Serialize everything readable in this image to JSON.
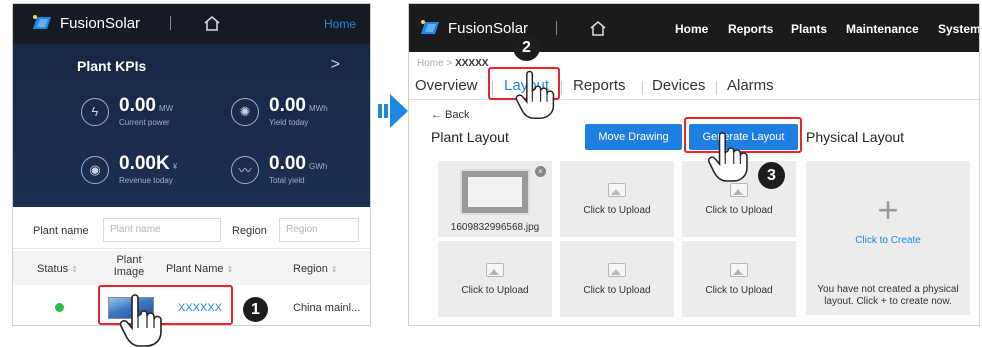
{
  "mobile": {
    "brand": "FusionSolar",
    "home_link": "Home",
    "kpi_title": "Plant KPIs",
    "kpi_arrow": ">",
    "kpis": [
      {
        "value": "0.00",
        "unit": "MW",
        "label": "Current power",
        "icon": "lightning-icon"
      },
      {
        "value": "0.00",
        "unit": "MWh",
        "label": "Yield today",
        "icon": "sun-icon"
      },
      {
        "value": "0.00K",
        "unit": "¥",
        "label": "Revenue today",
        "icon": "coins-icon"
      },
      {
        "value": "0.00",
        "unit": "GWh",
        "label": "Total yield",
        "icon": "chart-icon"
      }
    ],
    "filter": {
      "plant_name_label": "Plant name",
      "plant_name_placeholder": "Plant name",
      "region_label": "Region",
      "region_placeholder": "Region"
    },
    "table": {
      "headers": {
        "status": "Status",
        "image_line1": "Plant",
        "image_line2": "Image",
        "name": "Plant Name",
        "region": "Region"
      },
      "sort_glyph": "⇕",
      "row": {
        "name": "XXXXXX",
        "region": "China mainl..."
      }
    },
    "step": "1"
  },
  "web": {
    "brand": "FusionSolar",
    "nav": [
      "Home",
      "Reports",
      "Plants",
      "Maintenance",
      "System"
    ],
    "breadcrumb_home": "Home",
    "breadcrumb_sep": ">",
    "breadcrumb_current": "XXXXX",
    "tabs": [
      "Overview",
      "Layout",
      "Reports",
      "Devices",
      "Alarms"
    ],
    "back": "← Back",
    "plant_layout_title": "Plant Layout",
    "move_drawing": "Move Drawing",
    "generate_layout": "Generate Layout",
    "physical_layout_title": "Physical Layout",
    "file_name": "1609832996568.jpg",
    "upload_label": "Click to Upload",
    "create_link": "Click to Create",
    "create_plus": "+",
    "create_hint": "You have not created a physical layout. Click + to create now.",
    "step2": "2",
    "step3": "3"
  }
}
